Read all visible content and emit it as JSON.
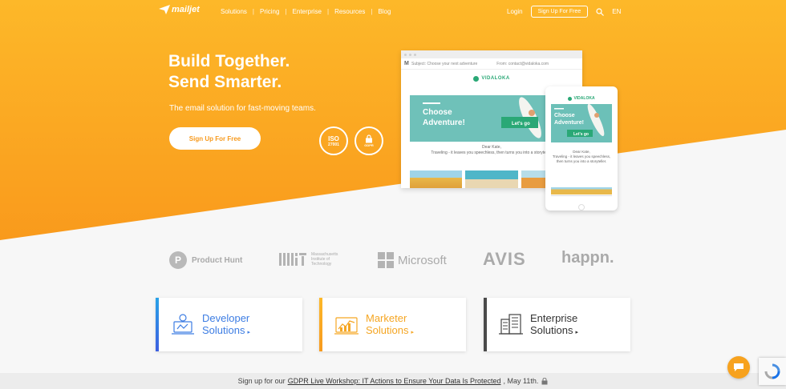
{
  "colors": {
    "brand_orange": "#fdb12b",
    "brand_orange_dark": "#f7911e",
    "developer_blue": "#3d7de3",
    "marketer_orange": "#f5a623",
    "enterprise_gray": "#4a4a4a",
    "vidaloka_green": "#2aa876"
  },
  "nav": {
    "logo": "mailjet",
    "links": [
      "Solutions",
      "Pricing",
      "Enterprise",
      "Resources",
      "Blog"
    ],
    "login": "Login",
    "signup": "Sign Up For Free",
    "search_icon": "search-icon",
    "lang": "EN"
  },
  "hero": {
    "title_line1": "Build Together.",
    "title_line2": "Send Smarter.",
    "subtitle": "The email solution for fast-moving teams.",
    "cta": "Sign Up For Free",
    "badge_iso": "ISO",
    "badge_iso_sub": "27001",
    "badge_gdpr": "GDPR"
  },
  "email_desktop": {
    "subject": "Subject: Choose your next adventure",
    "from": "From: contact@vidaloka.com",
    "brand": "VIDALOKA",
    "headline": "Choose Adventure!",
    "button": "Let's go",
    "greeting": "Dear Kate,",
    "body": "Traveling - it leaves you speechless, then turns you into a storyteller."
  },
  "email_mobile": {
    "brand": "VIDALOKA",
    "headline": "Choose Adventure!",
    "button": "Let's go",
    "greeting": "Dear Kate,",
    "body": "Traveling - it leaves you speechless, then turns you into a storyteller."
  },
  "logos": {
    "producthunt": "Product Hunt",
    "mit_line1": "Massachusetts",
    "mit_line2": "Institute of",
    "mit_line3": "Technology",
    "microsoft": "Microsoft",
    "avis": "AVIS",
    "happn": "happn."
  },
  "cards": {
    "developer": {
      "line1": "Developer",
      "line2": "Solutions"
    },
    "marketer": {
      "line1": "Marketer",
      "line2": "Solutions"
    },
    "enterprise": {
      "line1": "Enterprise",
      "line2": "Solutions"
    }
  },
  "banner": {
    "prefix": "Sign up for our",
    "link": "GDPR Live Workshop: IT Actions to Ensure Your Data Is Protected",
    "suffix": ", May 11th."
  }
}
